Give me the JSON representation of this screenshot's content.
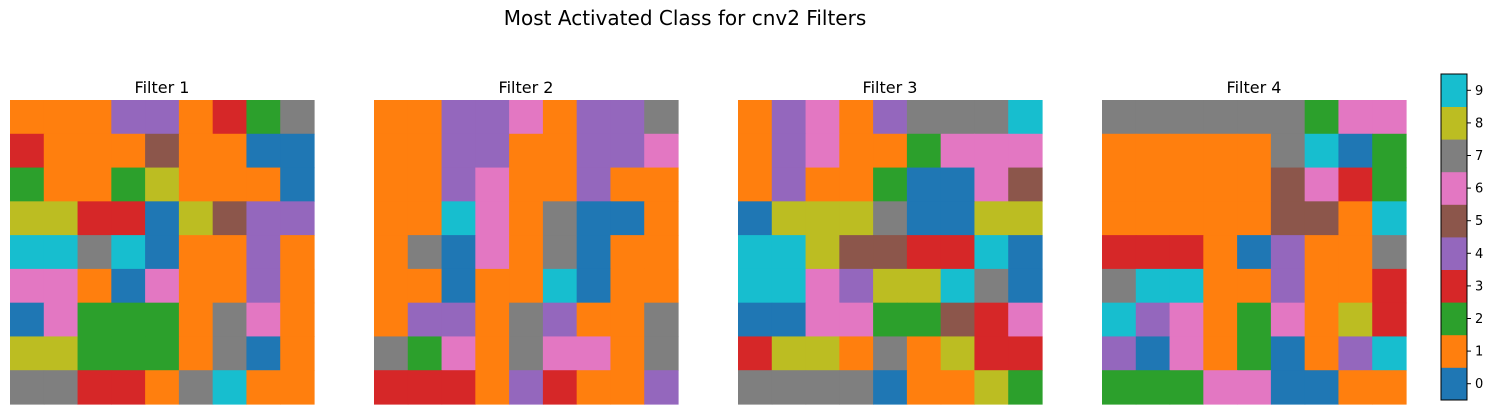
{
  "chart_data": {
    "type": "heatmap",
    "title": "Most Activated Class for cnv2 Filters",
    "colors": [
      "#1f77b4",
      "#ff7f0e",
      "#2ca02c",
      "#d62728",
      "#9467bd",
      "#8c564b",
      "#e377c2",
      "#7f7f7f",
      "#bcbd22",
      "#17becf"
    ],
    "colorbar": {
      "ticks": [
        "0",
        "1",
        "2",
        "3",
        "4",
        "5",
        "6",
        "7",
        "8",
        "9"
      ],
      "range": [
        -0.5,
        9.5
      ]
    },
    "panels": [
      {
        "title": "Filter 1",
        "grid": [
          [
            1,
            1,
            1,
            4,
            4,
            1,
            3,
            2,
            7
          ],
          [
            3,
            1,
            1,
            1,
            5,
            1,
            1,
            0,
            0
          ],
          [
            2,
            1,
            1,
            2,
            8,
            1,
            1,
            1,
            0
          ],
          [
            8,
            8,
            3,
            3,
            0,
            8,
            5,
            4,
            4
          ],
          [
            9,
            9,
            7,
            9,
            0,
            1,
            1,
            4,
            1
          ],
          [
            6,
            6,
            1,
            0,
            6,
            1,
            1,
            4,
            1
          ],
          [
            0,
            6,
            2,
            2,
            2,
            1,
            7,
            6,
            1
          ],
          [
            8,
            8,
            2,
            2,
            2,
            1,
            7,
            0,
            1
          ],
          [
            7,
            7,
            3,
            3,
            1,
            7,
            9,
            1,
            1
          ]
        ]
      },
      {
        "title": "Filter 2",
        "grid": [
          [
            1,
            1,
            4,
            4,
            6,
            1,
            4,
            4,
            7
          ],
          [
            1,
            1,
            4,
            4,
            1,
            1,
            4,
            4,
            6
          ],
          [
            1,
            1,
            4,
            6,
            1,
            1,
            4,
            1,
            1
          ],
          [
            1,
            1,
            9,
            6,
            1,
            7,
            0,
            0,
            1
          ],
          [
            1,
            7,
            0,
            6,
            1,
            7,
            0,
            1,
            1
          ],
          [
            1,
            1,
            0,
            1,
            1,
            9,
            0,
            1,
            1
          ],
          [
            1,
            4,
            4,
            1,
            7,
            4,
            1,
            1,
            7
          ],
          [
            7,
            2,
            6,
            1,
            7,
            6,
            6,
            1,
            7
          ],
          [
            3,
            3,
            3,
            1,
            4,
            3,
            1,
            1,
            4
          ]
        ]
      },
      {
        "title": "Filter 3",
        "grid": [
          [
            1,
            4,
            6,
            1,
            4,
            7,
            7,
            7,
            9
          ],
          [
            1,
            4,
            6,
            1,
            1,
            2,
            6,
            6,
            6
          ],
          [
            1,
            4,
            1,
            1,
            2,
            0,
            0,
            6,
            5
          ],
          [
            0,
            8,
            8,
            8,
            7,
            0,
            0,
            8,
            8
          ],
          [
            9,
            9,
            8,
            5,
            5,
            3,
            3,
            9,
            0
          ],
          [
            9,
            9,
            6,
            4,
            8,
            8,
            9,
            7,
            0
          ],
          [
            0,
            0,
            6,
            6,
            2,
            2,
            5,
            3,
            6
          ],
          [
            3,
            8,
            8,
            1,
            7,
            1,
            8,
            3,
            3
          ],
          [
            7,
            7,
            7,
            7,
            0,
            1,
            1,
            8,
            2
          ]
        ]
      },
      {
        "title": "Filter 4",
        "grid": [
          [
            7,
            7,
            7,
            7,
            7,
            7,
            2,
            6,
            6
          ],
          [
            1,
            1,
            1,
            1,
            1,
            7,
            9,
            0,
            2
          ],
          [
            1,
            1,
            1,
            1,
            1,
            5,
            6,
            3,
            2
          ],
          [
            1,
            1,
            1,
            1,
            1,
            5,
            5,
            1,
            9
          ],
          [
            3,
            3,
            3,
            1,
            0,
            4,
            1,
            1,
            7
          ],
          [
            7,
            9,
            9,
            1,
            1,
            4,
            1,
            1,
            3
          ],
          [
            9,
            4,
            6,
            1,
            2,
            6,
            1,
            8,
            3
          ],
          [
            4,
            0,
            6,
            1,
            2,
            0,
            1,
            4,
            9
          ],
          [
            2,
            2,
            2,
            6,
            6,
            0,
            0,
            1,
            1
          ]
        ]
      }
    ]
  }
}
